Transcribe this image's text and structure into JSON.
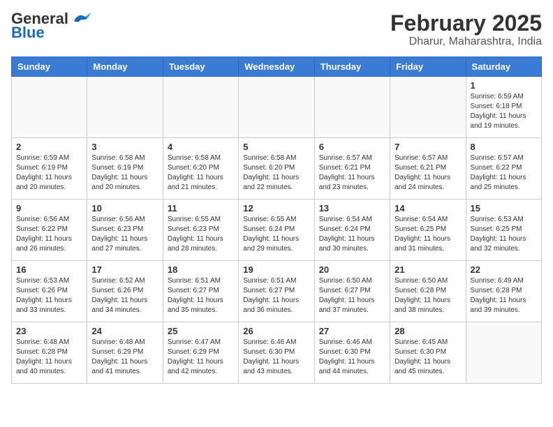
{
  "header": {
    "logo_line1": "General",
    "logo_line2": "Blue",
    "month": "February 2025",
    "location": "Dharur, Maharashtra, India"
  },
  "weekdays": [
    "Sunday",
    "Monday",
    "Tuesday",
    "Wednesday",
    "Thursday",
    "Friday",
    "Saturday"
  ],
  "weeks": [
    [
      {
        "day": "",
        "info": ""
      },
      {
        "day": "",
        "info": ""
      },
      {
        "day": "",
        "info": ""
      },
      {
        "day": "",
        "info": ""
      },
      {
        "day": "",
        "info": ""
      },
      {
        "day": "",
        "info": ""
      },
      {
        "day": "1",
        "info": "Sunrise: 6:59 AM\nSunset: 6:18 PM\nDaylight: 11 hours\nand 19 minutes."
      }
    ],
    [
      {
        "day": "2",
        "info": "Sunrise: 6:59 AM\nSunset: 6:19 PM\nDaylight: 11 hours\nand 20 minutes."
      },
      {
        "day": "3",
        "info": "Sunrise: 6:58 AM\nSunset: 6:19 PM\nDaylight: 11 hours\nand 20 minutes."
      },
      {
        "day": "4",
        "info": "Sunrise: 6:58 AM\nSunset: 6:20 PM\nDaylight: 11 hours\nand 21 minutes."
      },
      {
        "day": "5",
        "info": "Sunrise: 6:58 AM\nSunset: 6:20 PM\nDaylight: 11 hours\nand 22 minutes."
      },
      {
        "day": "6",
        "info": "Sunrise: 6:57 AM\nSunset: 6:21 PM\nDaylight: 11 hours\nand 23 minutes."
      },
      {
        "day": "7",
        "info": "Sunrise: 6:57 AM\nSunset: 6:21 PM\nDaylight: 11 hours\nand 24 minutes."
      },
      {
        "day": "8",
        "info": "Sunrise: 6:57 AM\nSunset: 6:22 PM\nDaylight: 11 hours\nand 25 minutes."
      }
    ],
    [
      {
        "day": "9",
        "info": "Sunrise: 6:56 AM\nSunset: 6:22 PM\nDaylight: 11 hours\nand 26 minutes."
      },
      {
        "day": "10",
        "info": "Sunrise: 6:56 AM\nSunset: 6:23 PM\nDaylight: 11 hours\nand 27 minutes."
      },
      {
        "day": "11",
        "info": "Sunrise: 6:55 AM\nSunset: 6:23 PM\nDaylight: 11 hours\nand 28 minutes."
      },
      {
        "day": "12",
        "info": "Sunrise: 6:55 AM\nSunset: 6:24 PM\nDaylight: 11 hours\nand 29 minutes."
      },
      {
        "day": "13",
        "info": "Sunrise: 6:54 AM\nSunset: 6:24 PM\nDaylight: 11 hours\nand 30 minutes."
      },
      {
        "day": "14",
        "info": "Sunrise: 6:54 AM\nSunset: 6:25 PM\nDaylight: 11 hours\nand 31 minutes."
      },
      {
        "day": "15",
        "info": "Sunrise: 6:53 AM\nSunset: 6:25 PM\nDaylight: 11 hours\nand 32 minutes."
      }
    ],
    [
      {
        "day": "16",
        "info": "Sunrise: 6:53 AM\nSunset: 6:26 PM\nDaylight: 11 hours\nand 33 minutes."
      },
      {
        "day": "17",
        "info": "Sunrise: 6:52 AM\nSunset: 6:26 PM\nDaylight: 11 hours\nand 34 minutes."
      },
      {
        "day": "18",
        "info": "Sunrise: 6:51 AM\nSunset: 6:27 PM\nDaylight: 11 hours\nand 35 minutes."
      },
      {
        "day": "19",
        "info": "Sunrise: 6:51 AM\nSunset: 6:27 PM\nDaylight: 11 hours\nand 36 minutes."
      },
      {
        "day": "20",
        "info": "Sunrise: 6:50 AM\nSunset: 6:27 PM\nDaylight: 11 hours\nand 37 minutes."
      },
      {
        "day": "21",
        "info": "Sunrise: 6:50 AM\nSunset: 6:28 PM\nDaylight: 11 hours\nand 38 minutes."
      },
      {
        "day": "22",
        "info": "Sunrise: 6:49 AM\nSunset: 6:28 PM\nDaylight: 11 hours\nand 39 minutes."
      }
    ],
    [
      {
        "day": "23",
        "info": "Sunrise: 6:48 AM\nSunset: 6:28 PM\nDaylight: 11 hours\nand 40 minutes."
      },
      {
        "day": "24",
        "info": "Sunrise: 6:48 AM\nSunset: 6:29 PM\nDaylight: 11 hours\nand 41 minutes."
      },
      {
        "day": "25",
        "info": "Sunrise: 6:47 AM\nSunset: 6:29 PM\nDaylight: 11 hours\nand 42 minutes."
      },
      {
        "day": "26",
        "info": "Sunrise: 6:46 AM\nSunset: 6:30 PM\nDaylight: 11 hours\nand 43 minutes."
      },
      {
        "day": "27",
        "info": "Sunrise: 6:46 AM\nSunset: 6:30 PM\nDaylight: 11 hours\nand 44 minutes."
      },
      {
        "day": "28",
        "info": "Sunrise: 6:45 AM\nSunset: 6:30 PM\nDaylight: 11 hours\nand 45 minutes."
      },
      {
        "day": "",
        "info": ""
      }
    ]
  ]
}
